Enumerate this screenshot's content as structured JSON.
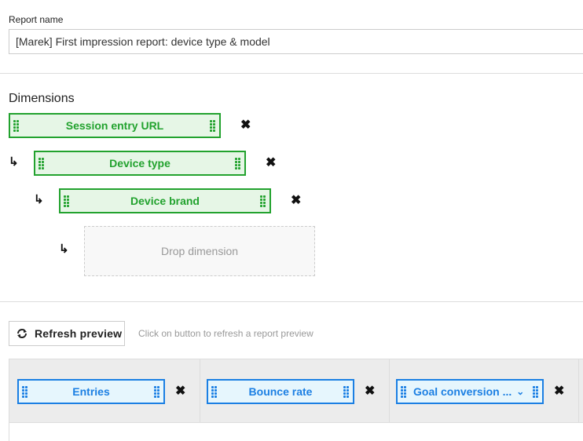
{
  "report": {
    "label": "Report name",
    "name_value": "[Marek] First impression report: device type & model"
  },
  "dimensions": {
    "title": "Dimensions",
    "items": [
      {
        "label": "Session entry URL"
      },
      {
        "label": "Device type"
      },
      {
        "label": "Device brand"
      }
    ],
    "drop_placeholder": "Drop dimension",
    "nested_arrow": "↳",
    "remove_icon": "✖"
  },
  "preview": {
    "refresh_label": "Refresh preview",
    "hint": "Click on button to refresh a report preview"
  },
  "metrics": {
    "items": [
      {
        "label": "Entries"
      },
      {
        "label": "Bounce rate"
      },
      {
        "label": "Goal conversion ...",
        "has_dropdown": true
      }
    ],
    "dropdown_icon": "⌄"
  },
  "colors": {
    "dimension_accent": "#22a22e",
    "dimension_bg": "#e6f6e6",
    "metric_accent": "#1b7fe3",
    "metric_bg": "#e6f6fd"
  }
}
